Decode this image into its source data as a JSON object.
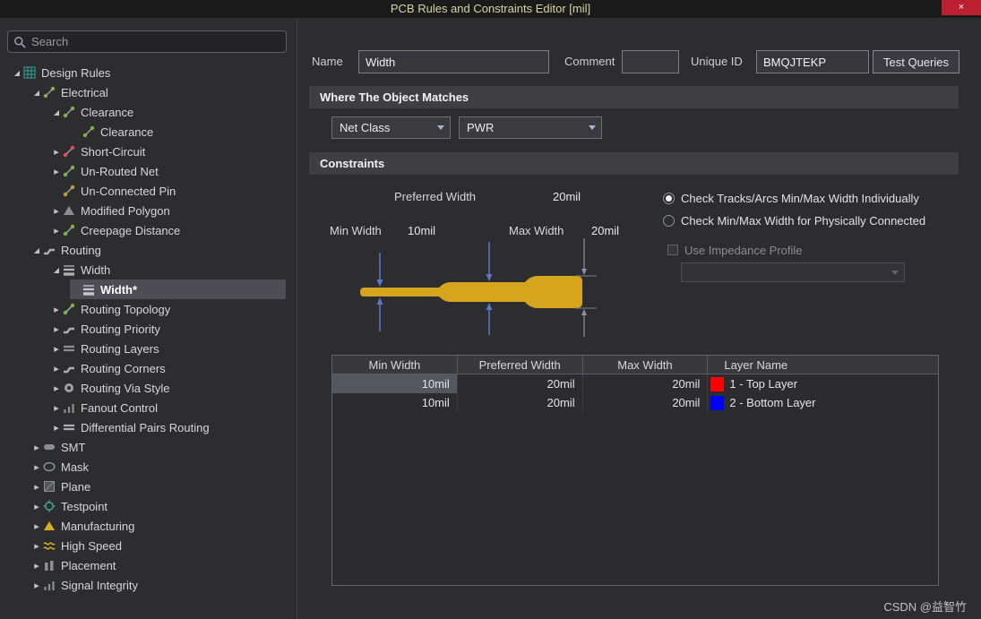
{
  "window": {
    "title": "PCB Rules and Constraints Editor [mil]",
    "close_glyph": "×"
  },
  "sidebar": {
    "search_placeholder": "Search",
    "tree": [
      {
        "label": "Design Rules",
        "level": 0,
        "state": "expanded",
        "icon": "design-rules"
      },
      {
        "label": "Electrical",
        "level": 1,
        "state": "expanded",
        "icon": "electrical"
      },
      {
        "label": "Clearance",
        "level": 2,
        "state": "expanded",
        "icon": "clearance"
      },
      {
        "label": "Clearance",
        "level": 3,
        "state": "leaf",
        "icon": "clearance-rule"
      },
      {
        "label": "Short-Circuit",
        "level": 2,
        "state": "collapsed",
        "icon": "short-circuit"
      },
      {
        "label": "Un-Routed Net",
        "level": 2,
        "state": "collapsed",
        "icon": "unrouted-net"
      },
      {
        "label": "Un-Connected Pin",
        "level": 2,
        "state": "leaf",
        "icon": "unconnected-pin"
      },
      {
        "label": "Modified Polygon",
        "level": 2,
        "state": "collapsed",
        "icon": "modified-polygon"
      },
      {
        "label": "Creepage Distance",
        "level": 2,
        "state": "collapsed",
        "icon": "creepage-distance"
      },
      {
        "label": "Routing",
        "level": 1,
        "state": "expanded",
        "icon": "routing"
      },
      {
        "label": "Width",
        "level": 2,
        "state": "expanded",
        "icon": "width"
      },
      {
        "label": "Width*",
        "level": 3,
        "state": "leaf",
        "icon": "width-rule",
        "selected": true
      },
      {
        "label": "Routing Topology",
        "level": 2,
        "state": "collapsed",
        "icon": "routing-topology"
      },
      {
        "label": "Routing Priority",
        "level": 2,
        "state": "collapsed",
        "icon": "routing-priority"
      },
      {
        "label": "Routing Layers",
        "level": 2,
        "state": "collapsed",
        "icon": "routing-layers"
      },
      {
        "label": "Routing Corners",
        "level": 2,
        "state": "collapsed",
        "icon": "routing-corners"
      },
      {
        "label": "Routing Via Style",
        "level": 2,
        "state": "collapsed",
        "icon": "routing-via"
      },
      {
        "label": "Fanout Control",
        "level": 2,
        "state": "collapsed",
        "icon": "fanout-control"
      },
      {
        "label": "Differential Pairs Routing",
        "level": 2,
        "state": "collapsed",
        "icon": "diff-pairs"
      },
      {
        "label": "SMT",
        "level": 1,
        "state": "collapsed",
        "icon": "smt"
      },
      {
        "label": "Mask",
        "level": 1,
        "state": "collapsed",
        "icon": "mask"
      },
      {
        "label": "Plane",
        "level": 1,
        "state": "collapsed",
        "icon": "plane"
      },
      {
        "label": "Testpoint",
        "level": 1,
        "state": "collapsed",
        "icon": "testpoint"
      },
      {
        "label": "Manufacturing",
        "level": 1,
        "state": "collapsed",
        "icon": "manufacturing"
      },
      {
        "label": "High Speed",
        "level": 1,
        "state": "collapsed",
        "icon": "high-speed"
      },
      {
        "label": "Placement",
        "level": 1,
        "state": "collapsed",
        "icon": "placement"
      },
      {
        "label": "Signal Integrity",
        "level": 1,
        "state": "collapsed",
        "icon": "signal-integrity"
      }
    ]
  },
  "form": {
    "name_label": "Name",
    "name_value": "Width",
    "comment_label": "Comment",
    "comment_value": "",
    "unique_id_label": "Unique ID",
    "unique_id_value": "BMQJTEKP",
    "test_queries_label": "Test Queries"
  },
  "where": {
    "header": "Where The Object Matches",
    "scope_value": "Net Class",
    "net_value": "PWR"
  },
  "constraints": {
    "header": "Constraints",
    "preferred_label": "Preferred Width",
    "preferred_value": "20mil",
    "min_label": "Min Width",
    "min_value": "10mil",
    "max_label": "Max Width",
    "max_value": "20mil",
    "radio_individual": "Check Tracks/Arcs Min/Max Width Individually",
    "radio_connected": "Check Min/Max Width for Physically Connected",
    "impedance_label": "Use Impedance Profile",
    "colors": {
      "track_gold": "#d6a51e",
      "arrow_blue": "#5b79c8",
      "arrow_gray": "#8891a8"
    },
    "table": {
      "columns": [
        "Min Width",
        "Preferred Width",
        "Max Width",
        "Layer Name"
      ],
      "rows": [
        {
          "min_width": "10mil",
          "preferred_width": "20mil",
          "max_width": "20mil",
          "layer_color": "#ff0000",
          "layer_name": "1 - Top Layer"
        },
        {
          "min_width": "10mil",
          "preferred_width": "20mil",
          "max_width": "20mil",
          "layer_color": "#0000ff",
          "layer_name": "2 - Bottom Layer"
        }
      ]
    }
  },
  "watermark": "CSDN @益智竹"
}
